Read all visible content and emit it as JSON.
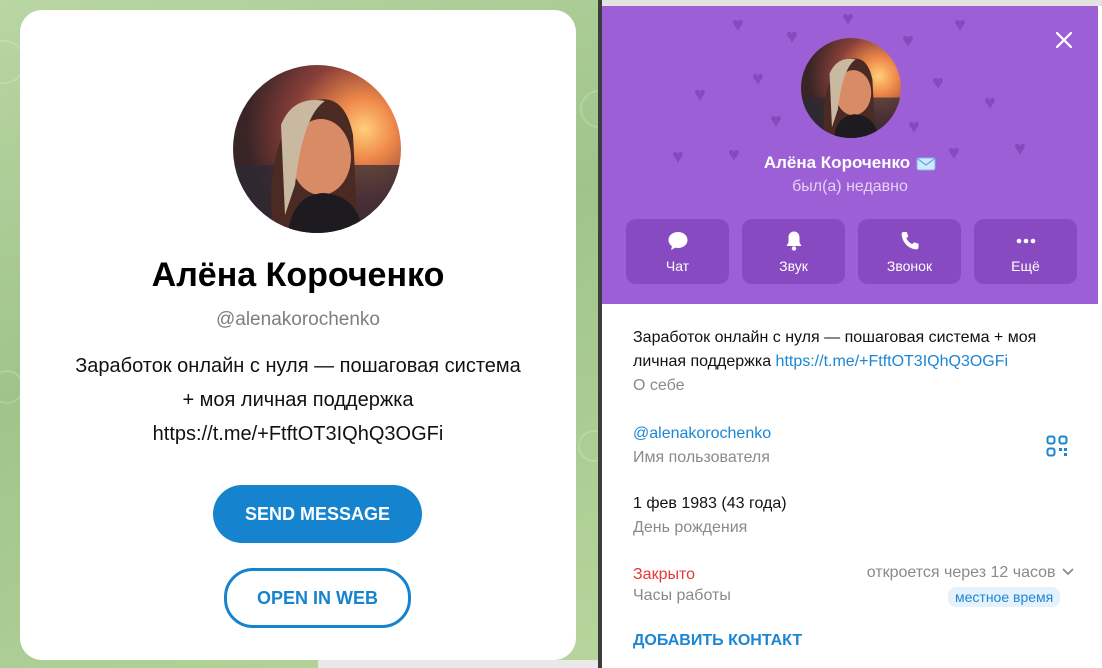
{
  "preview_card": {
    "name": "Алёна Короченко",
    "username": "@alenakorochenko",
    "bio_line1": "Заработок онлайн с нуля — пошаговая система",
    "bio_line2": "+ моя личная поддержка",
    "bio_line3": "https://t.me/+FtftOT3IQhQ3OGFi",
    "send_message_label": "SEND MESSAGE",
    "open_in_web_label": "OPEN IN WEB",
    "accent_color": "#1683cf"
  },
  "profile_panel": {
    "name": "Алёна Короченко",
    "status": "был(а) недавно",
    "header_color": "#9d5fd6",
    "actions": [
      {
        "label": "Чат",
        "icon": "chat-bubble-icon"
      },
      {
        "label": "Звук",
        "icon": "bell-icon"
      },
      {
        "label": "Звонок",
        "icon": "phone-icon"
      },
      {
        "label": "Ещё",
        "icon": "more-dots-icon"
      }
    ],
    "bio": {
      "text": "Заработок онлайн с нуля — пошаговая система + моя личная поддержка",
      "link": "https://t.me/+FtftOT3IQhQ3OGFi",
      "caption": "О себе"
    },
    "username": {
      "value": "@alenakorochenko",
      "caption": "Имя пользователя"
    },
    "birthday": {
      "value": "1 фев 1983 (43 года)",
      "caption": "День рождения"
    },
    "hours": {
      "state": "Закрыто",
      "caption": "Часы работы",
      "opens_in": "откроется через 12 часов",
      "badge": "местное время",
      "closed_color": "#e53935"
    },
    "add_contact_label": "ДОБАВИТЬ КОНТАКТ"
  }
}
